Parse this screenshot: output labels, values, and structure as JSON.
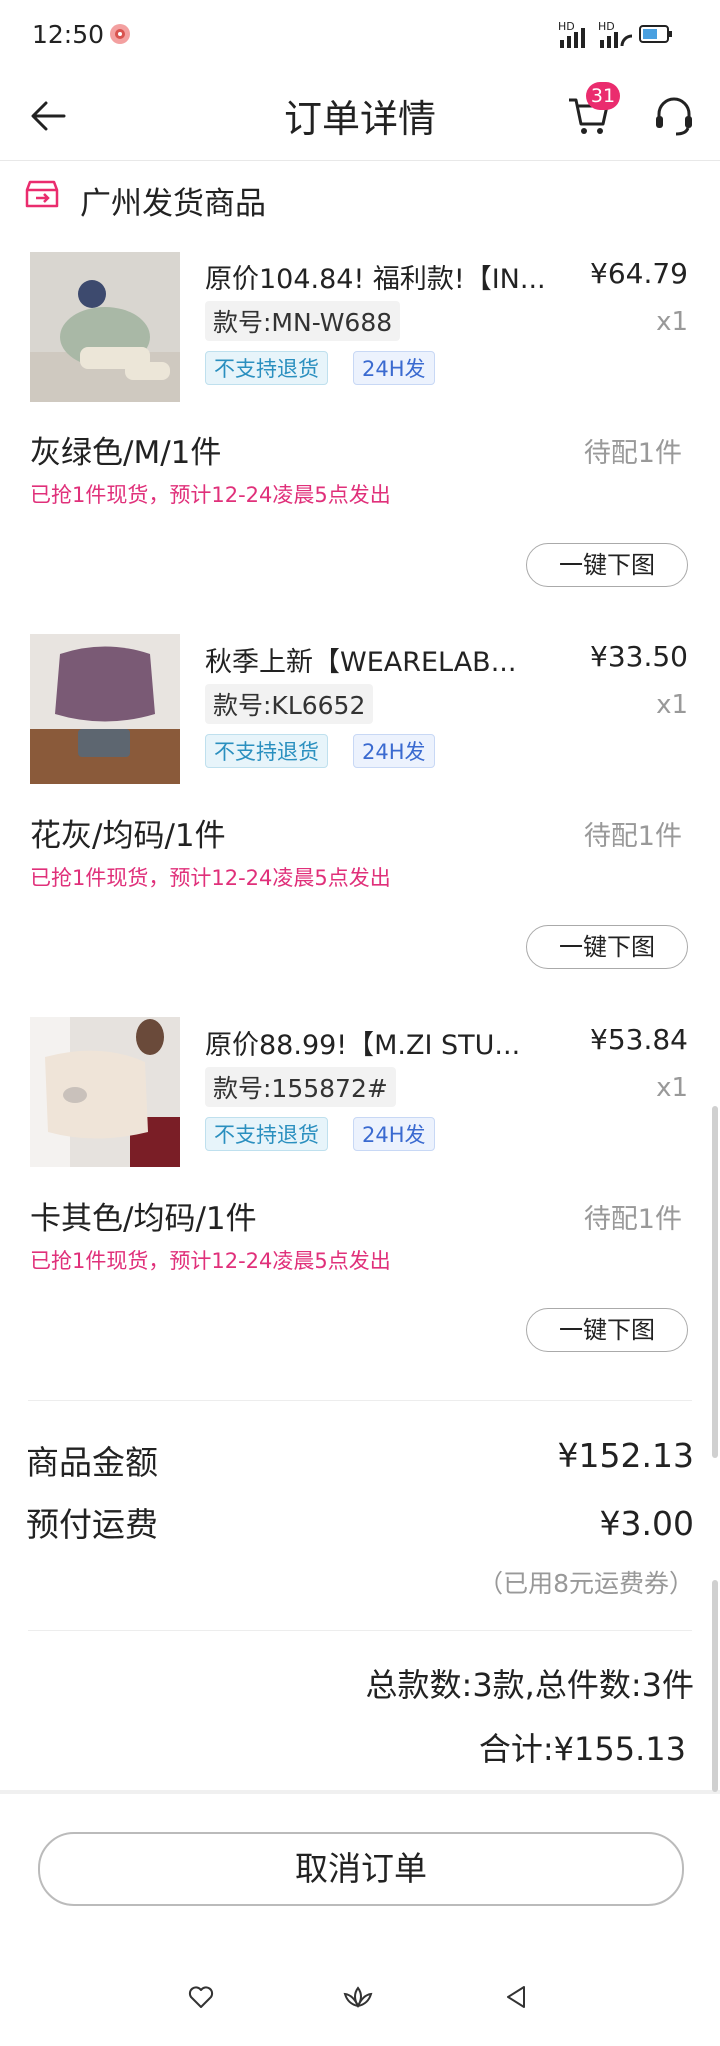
{
  "status_bar": {
    "time": "12:50"
  },
  "header": {
    "title": "订单详情",
    "cart_badge": "31"
  },
  "shop": {
    "label": "广州发货商品"
  },
  "products": [
    {
      "title": "原价104.84! 福利款!【IN...",
      "price": "¥64.79",
      "qty": "x1",
      "style_no": "款号:MN-W688",
      "tag_no_return": "不支持退货",
      "tag_24h": "24H发",
      "spec": "灰绿色/M/1件",
      "pending": "待配1件",
      "ship_note": "已抢1件现货，预计12-24凌晨5点发出",
      "download_label": "一键下图"
    },
    {
      "title": "秋季上新【WEARELAB...",
      "price": "¥33.50",
      "qty": "x1",
      "style_no": "款号:KL6652",
      "tag_no_return": "不支持退货",
      "tag_24h": "24H发",
      "spec": "花灰/均码/1件",
      "pending": "待配1件",
      "ship_note": "已抢1件现货，预计12-24凌晨5点发出",
      "download_label": "一键下图"
    },
    {
      "title": "原价88.99!【M.ZI STU...",
      "price": "¥53.84",
      "qty": "x1",
      "style_no": "款号:155872#",
      "tag_no_return": "不支持退货",
      "tag_24h": "24H发",
      "spec": "卡其色/均码/1件",
      "pending": "待配1件",
      "ship_note": "已抢1件现货，预计12-24凌晨5点发出",
      "download_label": "一键下图"
    }
  ],
  "summary": {
    "goods_label": "商品金额",
    "goods_value": "¥152.13",
    "freight_label": "预付运费",
    "freight_value": "¥3.00",
    "coupon_note": "（已用8元运费券）",
    "counts": "总款数:3款,总件数:3件",
    "total": "合计:¥155.13"
  },
  "actions": {
    "cancel_label": "取消订单"
  },
  "colors": {
    "accent": "#ea2c6e",
    "ship_note": "#e0307a",
    "tag_blue": "#2a8fbf"
  },
  "icons": [
    "back-arrow-icon",
    "cart-icon",
    "headset-icon",
    "shop-box-icon",
    "heart-icon",
    "lotus-icon",
    "back-triangle-icon"
  ]
}
